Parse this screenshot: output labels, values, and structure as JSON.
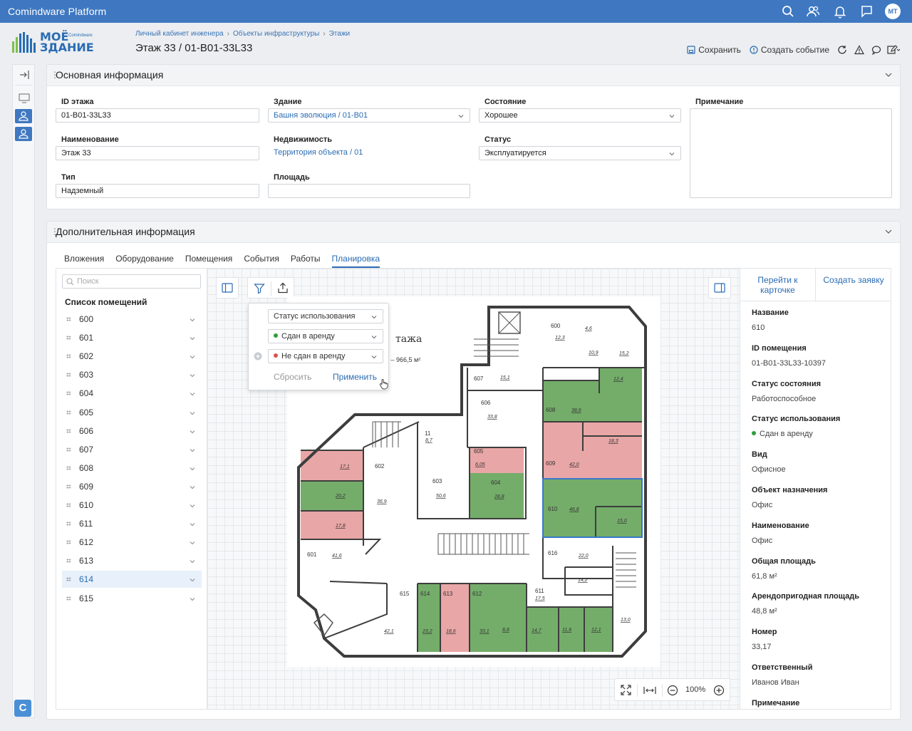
{
  "app": {
    "title": "Comindware Platform",
    "user_initials": "МТ"
  },
  "logo": {
    "line1": "МОЁ",
    "line2": "ЗДАНИЕ",
    "brand": "Comindware"
  },
  "breadcrumb": [
    "Личный кабинет инженера",
    "Объекты инфраструктуры",
    "Этажи"
  ],
  "page_title": "Этаж 33 / 01-B01-33L33",
  "toolbar": {
    "save": "Сохранить",
    "create_event": "Создать событие"
  },
  "main_panel": {
    "title": "Основная информация",
    "fields": {
      "floor_id": {
        "label": "ID этажа",
        "value": "01-B01-33L33"
      },
      "building": {
        "label": "Здание",
        "value": "Башня эволюция / 01-B01"
      },
      "state": {
        "label": "Состояние",
        "value": "Хорошее"
      },
      "note": {
        "label": "Примечание",
        "value": ""
      },
      "name": {
        "label": "Наименование",
        "value": "Этаж 33"
      },
      "property": {
        "label": "Недвижимость",
        "value": "Территория объекта / 01"
      },
      "status": {
        "label": "Статус",
        "value": "Эксплуатируется"
      },
      "type": {
        "label": "Тип",
        "value": "Надземный"
      },
      "area": {
        "label": "Площадь",
        "value": ""
      }
    }
  },
  "extra_panel": {
    "title": "Дополнительная информация",
    "tabs": [
      "Вложения",
      "Оборудование",
      "Помещения",
      "События",
      "Работы",
      "Планировка"
    ],
    "active_tab": "Планировка"
  },
  "room_list": {
    "search_placeholder": "Поиск",
    "header": "Список помещений",
    "rooms": [
      "600",
      "601",
      "602",
      "603",
      "604",
      "605",
      "606",
      "607",
      "608",
      "609",
      "610",
      "611",
      "612",
      "613",
      "614",
      "615"
    ],
    "selected": "614"
  },
  "filter_popup": {
    "field": "Статус использования",
    "values": [
      "Сдан в аренду",
      "Не сдан в аренду"
    ],
    "value_colors": [
      "#2e9e3a",
      "#d9534f"
    ],
    "reset": "Сбросить",
    "apply": "Применить"
  },
  "plan": {
    "heading_fragment": "тажа",
    "area_fragment": "дь – 966,5 м²",
    "rooms": [
      {
        "no": "600",
        "area": "12,3"
      },
      {
        "no": "",
        "area": "4,6"
      },
      {
        "no": "",
        "area": "10,9"
      },
      {
        "no": "",
        "area": "15,2"
      },
      {
        "no": "607",
        "area": "15,1"
      },
      {
        "no": "",
        "area": "12,4"
      },
      {
        "no": "606",
        "area": "33,8"
      },
      {
        "no": "608",
        "area": "38,6"
      },
      {
        "no": "11",
        "area": "8,7"
      },
      {
        "no": "605",
        "area": "6,05"
      },
      {
        "no": "",
        "area": "18,3"
      },
      {
        "no": "",
        "area": "17,1"
      },
      {
        "no": "602",
        "area": "36,9"
      },
      {
        "no": "609",
        "area": "42,0"
      },
      {
        "no": "603",
        "area": "50,6"
      },
      {
        "no": "604",
        "area": "28,8"
      },
      {
        "no": "",
        "area": "20,2"
      },
      {
        "no": "610",
        "area": "46,8"
      },
      {
        "no": "",
        "area": "15,0"
      },
      {
        "no": "",
        "area": "17,8"
      },
      {
        "no": "601",
        "area": "41,6"
      },
      {
        "no": "616",
        "area": "22,0"
      },
      {
        "no": "",
        "area": "14,2"
      },
      {
        "no": "615",
        "area": "42,1"
      },
      {
        "no": "614",
        "area": "23,2"
      },
      {
        "no": "613",
        "area": "18,6"
      },
      {
        "no": "612",
        "area": "33,1"
      },
      {
        "no": "",
        "area": "8,8"
      },
      {
        "no": "611",
        "area": "17,5"
      },
      {
        "no": "",
        "area": "14,7"
      },
      {
        "no": "",
        "area": "11,6"
      },
      {
        "no": "",
        "area": "12,1"
      },
      {
        "no": "",
        "area": "13,0"
      }
    ]
  },
  "zoom": {
    "level": "100%"
  },
  "details": {
    "actions": [
      "Перейти к карточке",
      "Создать заявку"
    ],
    "props": [
      {
        "k": "Название",
        "v": "610"
      },
      {
        "k": "ID помещения",
        "v": "01-B01-33L33-10397"
      },
      {
        "k": "Статус состояния",
        "v": "Работоспособное"
      },
      {
        "k": "Статус использования",
        "v": "Сдан в аренду"
      },
      {
        "k": "Вид",
        "v": "Офисное"
      },
      {
        "k": "Объект назначения",
        "v": "Офис"
      },
      {
        "k": "Наименование",
        "v": "Офис"
      },
      {
        "k": "Общая площадь",
        "v": "61,8 м²"
      },
      {
        "k": "Арендопригодная площадь",
        "v": "48,8 м²"
      },
      {
        "k": "Номер",
        "v": "33,17"
      },
      {
        "k": "Ответственный",
        "v": "Иванов Иван"
      },
      {
        "k": "Примечание",
        "v": ""
      }
    ]
  },
  "colors": {
    "accent": "#3f78c1",
    "rented": "#74ad6a",
    "not_rented": "#e9a6a6"
  },
  "help_letter": "C"
}
